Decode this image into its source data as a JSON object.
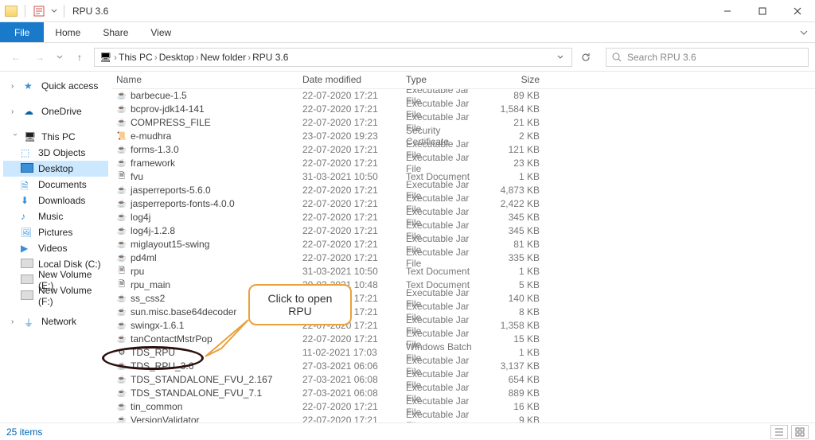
{
  "window": {
    "title": "RPU 3.6"
  },
  "ribbon": {
    "file": "File",
    "home": "Home",
    "share": "Share",
    "view": "View"
  },
  "nav": {
    "back": "←",
    "forward": "→"
  },
  "breadcrumb": [
    "This PC",
    "Desktop",
    "New folder",
    "RPU 3.6"
  ],
  "search": {
    "placeholder": "Search RPU 3.6"
  },
  "columns": {
    "name": "Name",
    "date": "Date modified",
    "type": "Type",
    "size": "Size"
  },
  "nav_pane": {
    "quick_access": "Quick access",
    "onedrive": "OneDrive",
    "this_pc": "This PC",
    "children": [
      {
        "label": "3D Objects",
        "icon": "ico-cube"
      },
      {
        "label": "Desktop",
        "icon": "ico-desktop",
        "selected": true
      },
      {
        "label": "Documents",
        "icon": "ico-doc"
      },
      {
        "label": "Downloads",
        "icon": "ico-dl"
      },
      {
        "label": "Music",
        "icon": "ico-music"
      },
      {
        "label": "Pictures",
        "icon": "ico-pic"
      },
      {
        "label": "Videos",
        "icon": "ico-vid"
      },
      {
        "label": "Local Disk (C:)",
        "icon": "ico-disk"
      },
      {
        "label": "New Volume (E:)",
        "icon": "ico-disk"
      },
      {
        "label": "New Volume (F:)",
        "icon": "ico-disk"
      }
    ],
    "network": "Network"
  },
  "files": [
    {
      "name": "barbecue-1.5",
      "date": "22-07-2020 17:21",
      "type": "Executable Jar File",
      "size": "89 KB",
      "icon": "fi-jar"
    },
    {
      "name": "bcprov-jdk14-141",
      "date": "22-07-2020 17:21",
      "type": "Executable Jar File",
      "size": "1,584 KB",
      "icon": "fi-jar"
    },
    {
      "name": "COMPRESS_FILE",
      "date": "22-07-2020 17:21",
      "type": "Executable Jar File",
      "size": "21 KB",
      "icon": "fi-jar"
    },
    {
      "name": "e-mudhra",
      "date": "23-07-2020 19:23",
      "type": "Security Certificate",
      "size": "2 KB",
      "icon": "fi-cert"
    },
    {
      "name": "forms-1.3.0",
      "date": "22-07-2020 17:21",
      "type": "Executable Jar File",
      "size": "121 KB",
      "icon": "fi-jar"
    },
    {
      "name": "framework",
      "date": "22-07-2020 17:21",
      "type": "Executable Jar File",
      "size": "23 KB",
      "icon": "fi-jar"
    },
    {
      "name": "fvu",
      "date": "31-03-2021 10:50",
      "type": "Text Document",
      "size": "1 KB",
      "icon": "fi-txt"
    },
    {
      "name": "jasperreports-5.6.0",
      "date": "22-07-2020 17:21",
      "type": "Executable Jar File",
      "size": "4,873 KB",
      "icon": "fi-jar"
    },
    {
      "name": "jasperreports-fonts-4.0.0",
      "date": "22-07-2020 17:21",
      "type": "Executable Jar File",
      "size": "2,422 KB",
      "icon": "fi-jar"
    },
    {
      "name": "log4j",
      "date": "22-07-2020 17:21",
      "type": "Executable Jar File",
      "size": "345 KB",
      "icon": "fi-jar"
    },
    {
      "name": "log4j-1.2.8",
      "date": "22-07-2020 17:21",
      "type": "Executable Jar File",
      "size": "345 KB",
      "icon": "fi-jar"
    },
    {
      "name": "miglayout15-swing",
      "date": "22-07-2020 17:21",
      "type": "Executable Jar File",
      "size": "81 KB",
      "icon": "fi-jar"
    },
    {
      "name": "pd4ml",
      "date": "22-07-2020 17:21",
      "type": "Executable Jar File",
      "size": "335 KB",
      "icon": "fi-jar"
    },
    {
      "name": "rpu",
      "date": "31-03-2021 10:50",
      "type": "Text Document",
      "size": "1 KB",
      "icon": "fi-txt"
    },
    {
      "name": "rpu_main",
      "date": "30-03-2021 10:48",
      "type": "Text Document",
      "size": "5 KB",
      "icon": "fi-txt"
    },
    {
      "name": "ss_css2",
      "date": "22-07-2020 17:21",
      "type": "Executable Jar File",
      "size": "140 KB",
      "icon": "fi-jar"
    },
    {
      "name": "sun.misc.base64decoder",
      "date": "22-07-2020 17:21",
      "type": "Executable Jar File",
      "size": "8 KB",
      "icon": "fi-jar"
    },
    {
      "name": "swingx-1.6.1",
      "date": "22-07-2020 17:21",
      "type": "Executable Jar File",
      "size": "1,358 KB",
      "icon": "fi-jar"
    },
    {
      "name": "tanContactMstrPop",
      "date": "22-07-2020 17:21",
      "type": "Executable Jar File",
      "size": "15 KB",
      "icon": "fi-jar"
    },
    {
      "name": "TDS_RPU",
      "date": "11-02-2021 17:03",
      "type": "Windows Batch File",
      "size": "1 KB",
      "icon": "fi-bat"
    },
    {
      "name": "TDS_RPU_3.6",
      "date": "27-03-2021 06:06",
      "type": "Executable Jar File",
      "size": "3,137 KB",
      "icon": "fi-jar"
    },
    {
      "name": "TDS_STANDALONE_FVU_2.167",
      "date": "27-03-2021 06:08",
      "type": "Executable Jar File",
      "size": "654 KB",
      "icon": "fi-jar"
    },
    {
      "name": "TDS_STANDALONE_FVU_7.1",
      "date": "27-03-2021 06:08",
      "type": "Executable Jar File",
      "size": "889 KB",
      "icon": "fi-jar"
    },
    {
      "name": "tin_common",
      "date": "22-07-2020 17:21",
      "type": "Executable Jar File",
      "size": "16 KB",
      "icon": "fi-jar"
    },
    {
      "name": "VersionValidator",
      "date": "22-07-2020 17:21",
      "type": "Executable Jar File",
      "size": "9 KB",
      "icon": "fi-jar"
    }
  ],
  "status": {
    "count": "25 items"
  },
  "callout": {
    "text": "Click to open RPU"
  }
}
